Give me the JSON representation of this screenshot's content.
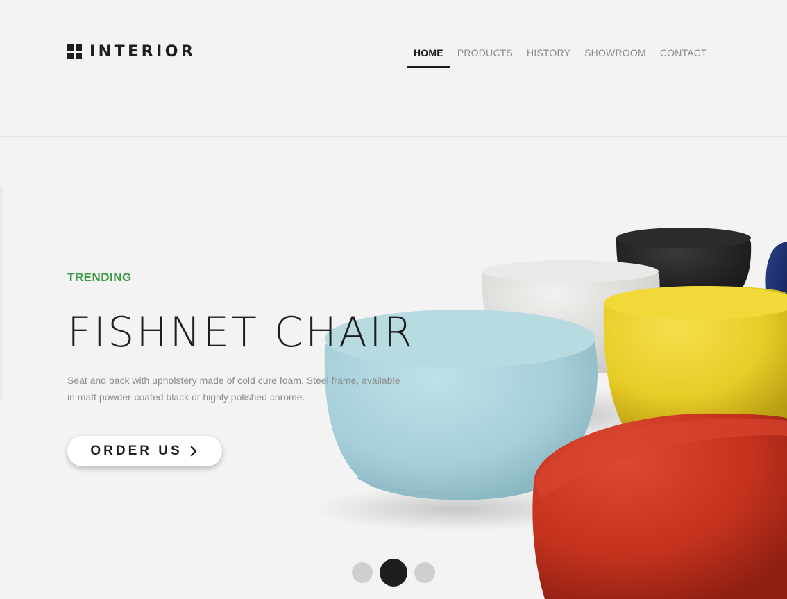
{
  "brand": {
    "name": "INTERIOR"
  },
  "nav": {
    "items": [
      {
        "label": "HOME",
        "active": true
      },
      {
        "label": "PRODUCTS",
        "active": false
      },
      {
        "label": "HISTORY",
        "active": false
      },
      {
        "label": "SHOWROOM",
        "active": false
      },
      {
        "label": "CONTACT",
        "active": false
      }
    ]
  },
  "hero": {
    "eyebrow": "TRENDING",
    "title": "FISHNET CHAIR",
    "description": "Seat and back with upholstery made of cold cure foam. Steel frame, available in matt powder-coated black or highly polished chrome.",
    "cta_label": "ORDER US",
    "cta_icon": "chevron-right-icon",
    "slides_total": 3,
    "active_slide": 2
  },
  "colors": {
    "accent": "#3e9a45",
    "text_dark": "#1e1e1e",
    "background": "#f3f3f3",
    "pouf_light_blue": "#a9d3dc",
    "pouf_red": "#c8331f",
    "pouf_yellow": "#ecd12c",
    "pouf_white": "#e7e7e5",
    "pouf_black": "#1c1c1c",
    "pouf_navy": "#1d2f6e"
  }
}
